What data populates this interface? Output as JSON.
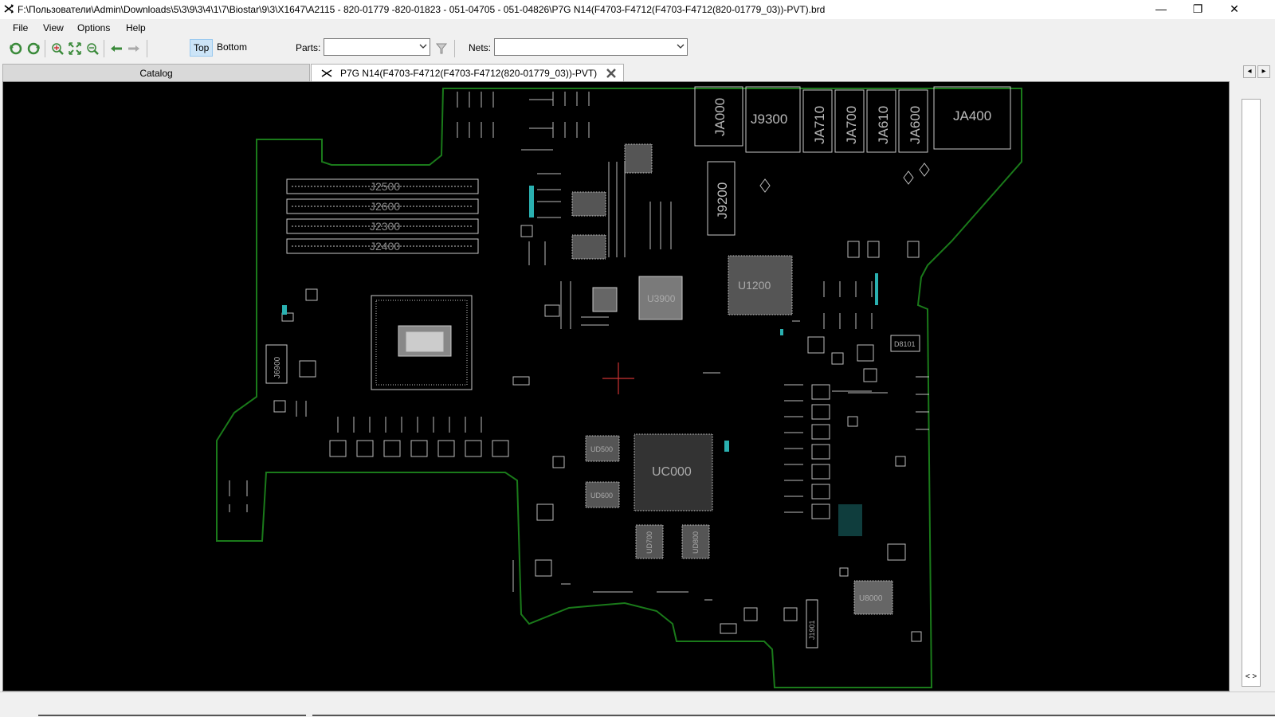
{
  "window": {
    "title": "F:\\Пользователи\\Admin\\Downloads\\5\\3\\9\\3\\4\\1\\7\\Biostar\\9\\3\\X1647\\A2115 - 820-01779 -820-01823 - 051-04705 - 051-04826\\P7G N14(F4703-F4712(F4703-F4712(820-01779_03))-PVT).brd",
    "minimize": "—",
    "restore": "❐",
    "close": "✕"
  },
  "menu": {
    "file": "File",
    "view": "View",
    "options": "Options",
    "help": "Help"
  },
  "toolbar": {
    "top_label": "Top",
    "bottom_label": "Bottom",
    "parts_label": "Parts:",
    "parts_value": "",
    "nets_label": "Nets:",
    "nets_value": ""
  },
  "tabs": {
    "catalog": "Catalog",
    "board": "P7G N14(F4703-F4712(F4703-F4712(820-01779_03))-PVT)"
  },
  "board_labels": {
    "ja000": "JA000",
    "j9300": "J9300",
    "ja710": "JA710",
    "ja700": "JA700",
    "ja610": "JA610",
    "ja600": "JA600",
    "ja400": "JA400",
    "j2500": "J2500",
    "j2600": "J2600",
    "j2300": "J2300",
    "j2400": "J2400",
    "j9200": "J9200",
    "u3900": "U3900",
    "u1200": "U1200",
    "j6900": "J6900",
    "d8101": "D8101",
    "ud500": "UD500",
    "ud600": "UD600",
    "uc000": "UC000",
    "ud700": "UD700",
    "ud800": "UD800",
    "u8000": "U8000",
    "j1901": "J1901"
  },
  "colors": {
    "board_outline": "#1a7a1a",
    "silkscreen": "#c8c8c8",
    "canvas_bg": "#000000",
    "via_accent": "#2ab0b0",
    "cursor": "#cc3333"
  },
  "icons": {
    "app": "crossed-arrows-icon",
    "rotate_left": "rotate-left-icon",
    "rotate_right": "rotate-right-icon",
    "zoom_in": "zoom-in-icon",
    "zoom_fit": "zoom-fit-icon",
    "zoom_out": "zoom-out-icon",
    "back": "arrow-left-icon",
    "forward": "arrow-right-icon",
    "search": "magnifier-icon"
  }
}
